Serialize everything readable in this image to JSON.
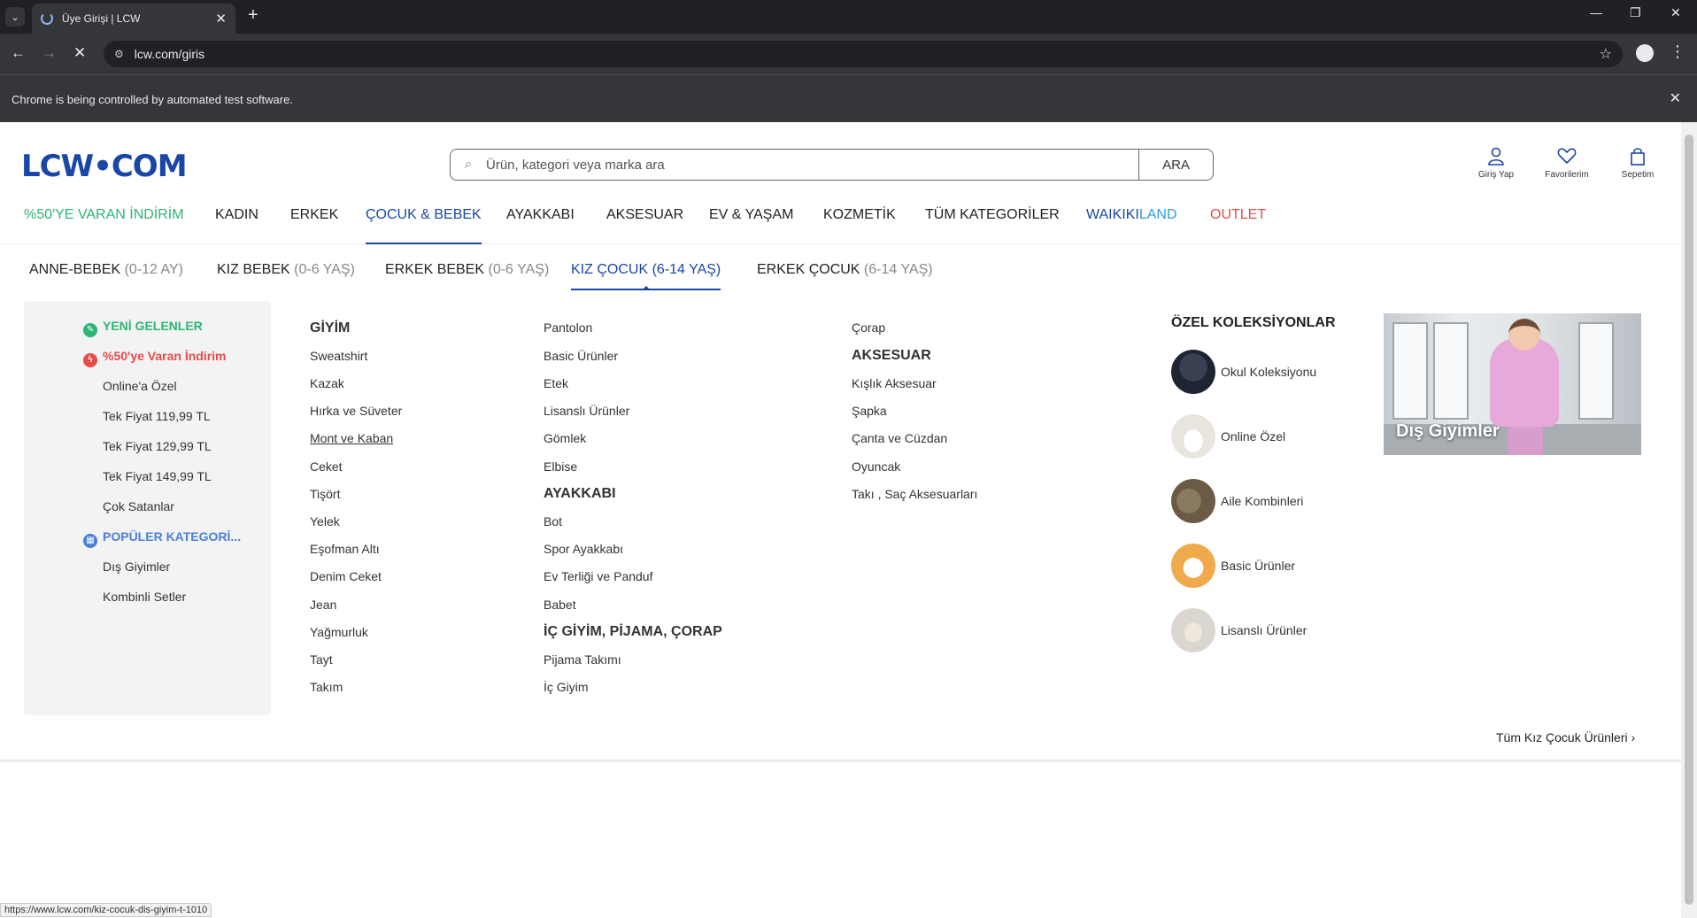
{
  "browser": {
    "tab_title": "Üye Girişi | LCW",
    "url": "lcw.com/giris",
    "infobar_text": "Chrome is being controlled by automated test software.",
    "status_url": "https://www.lcw.com/kiz-cocuk-dis-giyim-t-1010"
  },
  "header": {
    "logo": "LCW•COM",
    "search_placeholder": "Ürün, kategori veya marka ara",
    "search_button": "ARA",
    "actions": {
      "login": "Giriş Yap",
      "favorites": "Favorilerim",
      "cart": "Sepetim"
    }
  },
  "main_nav": [
    {
      "label": "%50'YE VARAN İNDİRİM",
      "color": "#2bb673"
    },
    {
      "label": "KADIN"
    },
    {
      "label": "ERKEK"
    },
    {
      "label": "ÇOCUK & BEBEK",
      "active": true
    },
    {
      "label": "AYAKKABI"
    },
    {
      "label": "AKSESUAR"
    },
    {
      "label": "EV & YAŞAM"
    },
    {
      "label": "KOZMETİK"
    },
    {
      "label": "TÜM KATEGORİLER"
    },
    {
      "label_a": "WAIKIKI",
      "label_b": "LAND"
    },
    {
      "label": "OUTLET",
      "color": "#e64b4b"
    }
  ],
  "sub_nav": [
    {
      "label": "ANNE-BEBEK",
      "age": "(0-12 AY)"
    },
    {
      "label": "KIZ BEBEK",
      "age": "(0-6 YAŞ)"
    },
    {
      "label": "ERKEK BEBEK",
      "age": "(0-6 YAŞ)"
    },
    {
      "label": "KIZ ÇOCUK",
      "age": "(6-14 YAŞ)",
      "active": true
    },
    {
      "label": "ERKEK ÇOCUK",
      "age": "(6-14 YAŞ)"
    }
  ],
  "left_panel": [
    {
      "label": "YENİ GELENLER",
      "style": "green",
      "icon": "leaf-icon"
    },
    {
      "label": "%50'ye Varan İndirim",
      "style": "red",
      "icon": "bolt-icon"
    },
    {
      "label": "Online'a Özel"
    },
    {
      "label": "Tek Fiyat 119,99 TL"
    },
    {
      "label": "Tek Fiyat 129,99 TL"
    },
    {
      "label": "Tek Fiyat 149,99 TL"
    },
    {
      "label": "Çok Satanlar"
    },
    {
      "label": "POPÜLER KATEGORİ...",
      "style": "blue",
      "icon": "grid-icon"
    },
    {
      "label": "Dış Giyimler"
    },
    {
      "label": "Kombinli Setler"
    }
  ],
  "col1": {
    "heading": "GİYİM",
    "items": [
      "Sweatshirt",
      "Kazak",
      "Hırka ve Süveter",
      "Mont ve Kaban",
      "Ceket",
      "Tişört",
      "Yelek",
      "Eşofman Altı",
      "Denim Ceket",
      "Jean",
      "Yağmurluk",
      "Tayt",
      "Takım"
    ]
  },
  "col2": {
    "items_a": [
      "Pantolon",
      "Basic Ürünler",
      "Etek",
      "Lisanslı Ürünler",
      "Gömlek",
      "Elbise"
    ],
    "heading_b": "AYAKKABI",
    "items_b": [
      "Bot",
      "Spor Ayakkabı",
      "Ev Terliği ve Panduf",
      "Babet"
    ],
    "heading_c": "İÇ GİYİM, PİJAMA, ÇORAP",
    "items_c": [
      "Pijama Takımı",
      "İç Giyim"
    ]
  },
  "col3": {
    "items_a": [
      "Çorap"
    ],
    "heading_b": "AKSESUAR",
    "items_b": [
      "Kışlık Aksesuar",
      "Şapka",
      "Çanta ve Cüzdan",
      "Oyuncak",
      "Takı , Saç Aksesuarları"
    ]
  },
  "collections": {
    "heading": "ÖZEL KOLEKSİYONLAR",
    "items": [
      {
        "label": "Okul Koleksiyonu",
        "color": "#1f2433"
      },
      {
        "label": "Online Özel",
        "color": "#e9e4de"
      },
      {
        "label": "Aile Kombinleri",
        "color": "#6b5b45"
      },
      {
        "label": "Basic Ürünler",
        "color": "#f0a94b"
      },
      {
        "label": "Lisanslı Ürünler",
        "color": "#dcd6d0"
      }
    ]
  },
  "promo": {
    "label": "Dış Giyimler"
  },
  "all_link": "Tüm Kız Çocuk Ürünleri ›"
}
